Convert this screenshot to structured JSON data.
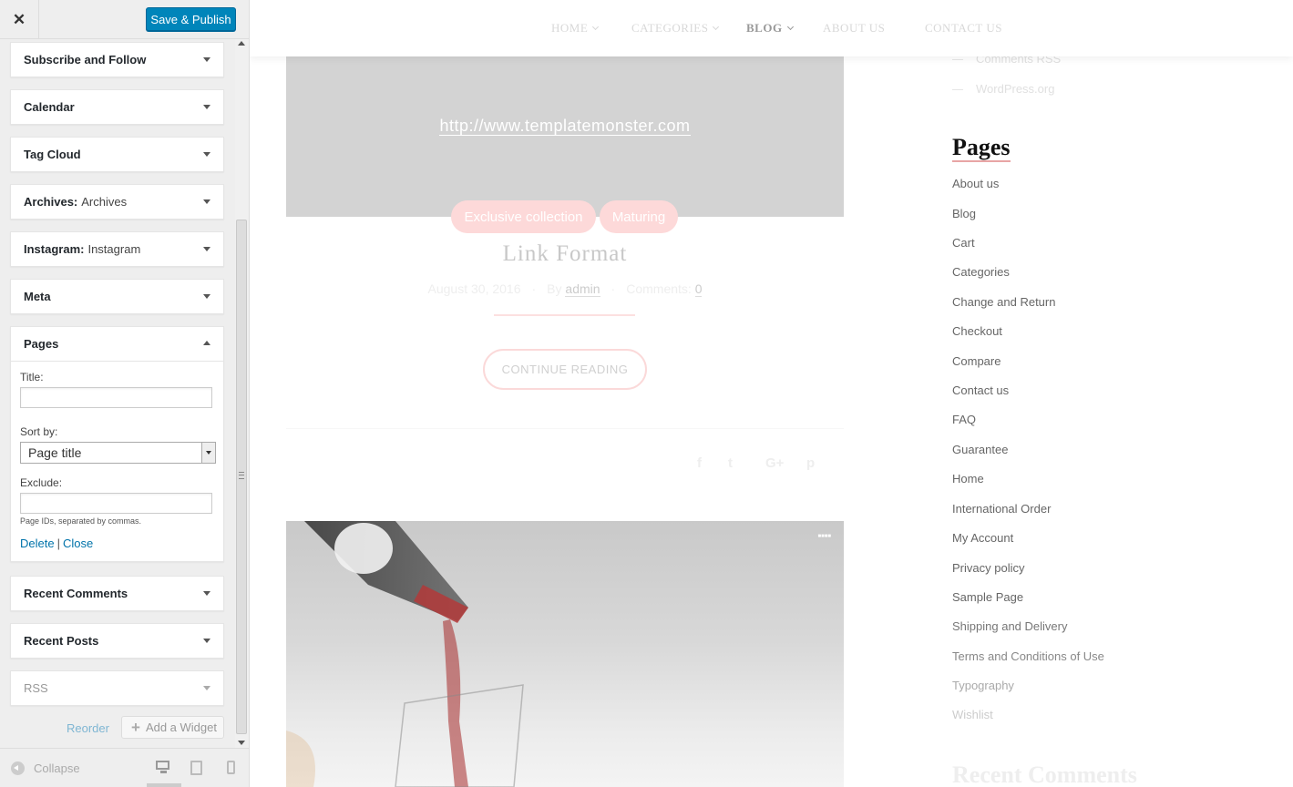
{
  "customizer": {
    "close_label": "✕",
    "save_label": "Save & Publish",
    "widgets": [
      {
        "title": "Subscribe and Follow",
        "sub": ""
      },
      {
        "title": "Calendar",
        "sub": ""
      },
      {
        "title": "Tag Cloud",
        "sub": ""
      },
      {
        "title": "Archives:",
        "sub": "Archives"
      },
      {
        "title": "Instagram:",
        "sub": "Instagram"
      },
      {
        "title": "Meta",
        "sub": ""
      }
    ],
    "pages_widget": {
      "title": "Pages",
      "title_label": "Title:",
      "title_value": "",
      "sort_label": "Sort by:",
      "sort_value": "Page title",
      "exclude_label": "Exclude:",
      "exclude_value": "",
      "help_text": "Page IDs, separated by commas.",
      "delete_label": "Delete",
      "separator": "|",
      "close_label": "Close"
    },
    "widgets_after": [
      {
        "title": "Recent Comments"
      },
      {
        "title": "Recent Posts"
      },
      {
        "title": "RSS"
      }
    ],
    "reorder_label": "Reorder",
    "add_widget_label": "Add a Widget",
    "collapse_label": "Collapse"
  },
  "preview": {
    "nav": [
      {
        "label": "HOME",
        "dropdown": true
      },
      {
        "label": "CATEGORIES",
        "dropdown": true
      },
      {
        "label": "BLOG",
        "dropdown": true
      },
      {
        "label": "ABOUT US",
        "dropdown": false
      },
      {
        "label": "CONTACT US",
        "dropdown": false
      }
    ],
    "post": {
      "link_url": "http://www.templatemonster.com",
      "tags": [
        "Exclusive collection",
        "Maturing"
      ],
      "title": "Link Format",
      "date": "August 30, 2016",
      "by_label": "By",
      "author": "admin",
      "comments_label": "Comments:",
      "comments_count": "0",
      "continue_label": "CONTINUE READING",
      "social_icons": [
        "facebook-icon",
        "twitter-icon",
        "google-plus-icon",
        "pinterest-icon"
      ]
    },
    "sidebar": {
      "meta_links": [
        "Comments RSS",
        "WordPress.org"
      ],
      "pages_heading": "Pages",
      "pages": [
        "About us",
        "Blog",
        "Cart",
        "Categories",
        "Change and Return",
        "Checkout",
        "Compare",
        "Contact us",
        "FAQ",
        "Guarantee",
        "Home",
        "International Order",
        "My Account",
        "Privacy policy",
        "Sample Page",
        "Shipping and Delivery",
        "Terms and Conditions of Use",
        "Typography",
        "Wishlist"
      ],
      "recent_comments_heading": "Recent Comments"
    }
  },
  "colors": {
    "primary_button": "#0085ba",
    "link": "#0073aa",
    "tag_pill": "#fdd9d9"
  }
}
